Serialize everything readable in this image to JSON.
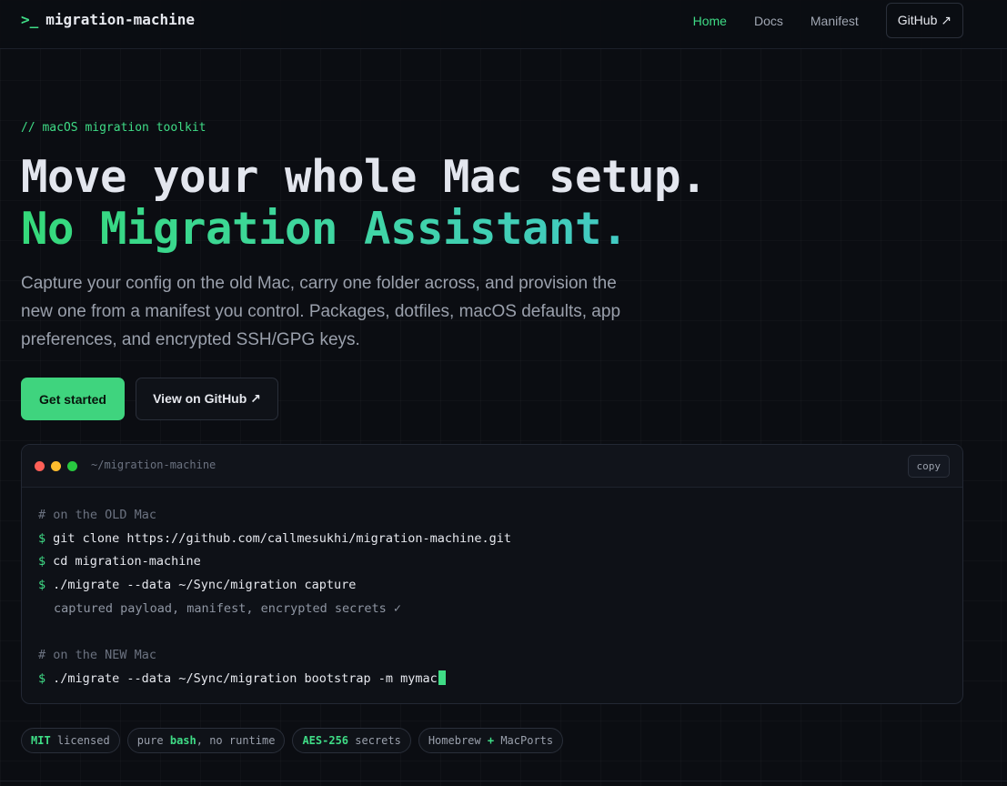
{
  "nav": {
    "brand_prompt": ">_",
    "brand_name": "migration-machine",
    "links": [
      {
        "label": "Home",
        "active": true
      },
      {
        "label": "Docs",
        "active": false
      },
      {
        "label": "Manifest",
        "active": false
      }
    ],
    "github_label": "GitHub ↗"
  },
  "hero": {
    "eyebrow": "// macOS migration toolkit",
    "title_line1": "Move your whole Mac setup.",
    "title_line2": "No Migration Assistant.",
    "lede": "Capture your config on the old Mac, carry one folder across, and provision the new one from a manifest you control. Packages, dotfiles, macOS defaults, app preferences, and encrypted SSH/GPG keys.",
    "primary_button": "Get started",
    "secondary_button": "View on GitHub ↗"
  },
  "terminal": {
    "title": "~/migration-machine",
    "copy_label": "copy",
    "prompt": "$",
    "lines": {
      "c1": "# on the OLD Mac",
      "l1": "git clone https://github.com/callmesukhi/migration-machine.git",
      "l2": "cd migration-machine",
      "l3": "./migrate --data ~/Sync/migration capture",
      "o1": "captured payload, manifest, encrypted secrets ✓",
      "c2": "# on the NEW Mac",
      "l4": "./migrate --data ~/Sync/migration bootstrap -m mymac"
    }
  },
  "badges": [
    {
      "hl": "MIT",
      "rest": " licensed"
    },
    {
      "pre": "pure ",
      "hl": "bash",
      "rest": ", no runtime"
    },
    {
      "hl": "AES-256",
      "rest": " secrets"
    },
    {
      "pre": "Homebrew ",
      "hl": "+",
      "rest": " MacPorts"
    }
  ],
  "colors": {
    "accent": "#3fdc86",
    "background": "#0b0d12"
  }
}
